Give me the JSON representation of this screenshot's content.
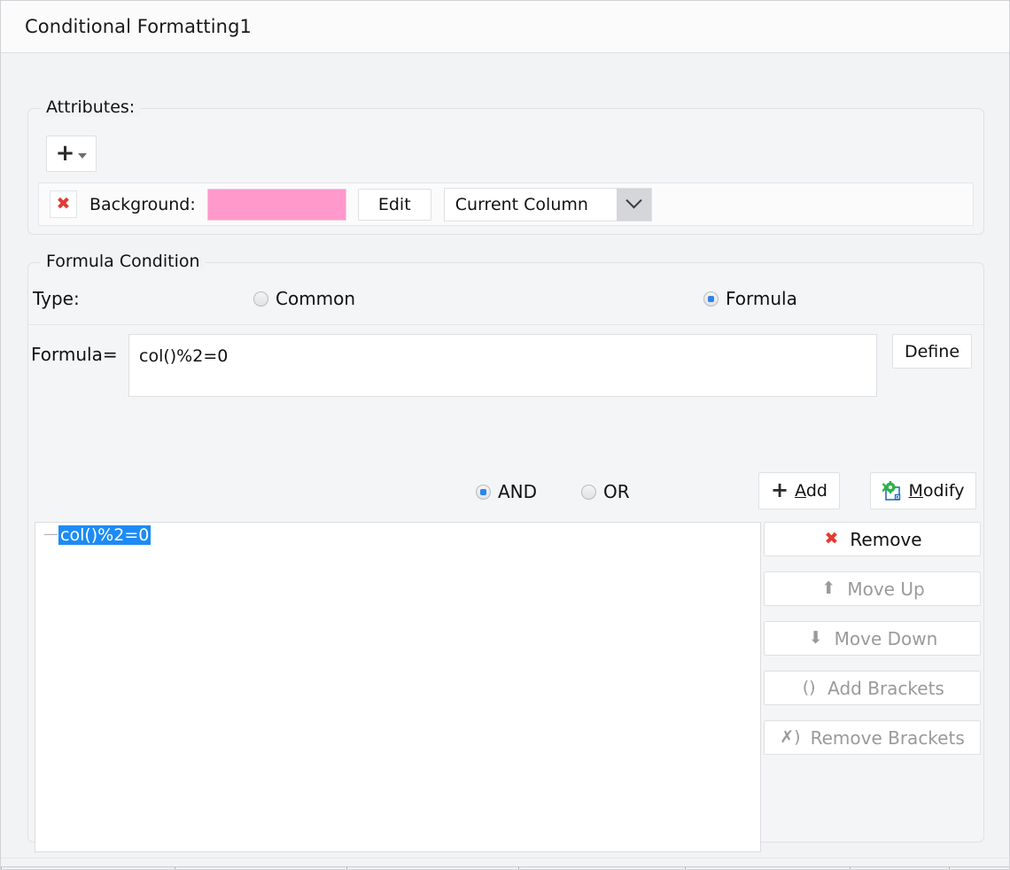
{
  "window": {
    "title": "Conditional Formatting1"
  },
  "attributes": {
    "group_label": "Attributes:",
    "add_button": {
      "icon": "plus-icon",
      "dropdown_icon": "caret-down-icon"
    },
    "rows": [
      {
        "remove_icon": "red-x-icon",
        "label": "Background:",
        "swatch_color": "#ff99cc",
        "edit_label": "Edit",
        "scope_value": "Current Column",
        "scope_arrow_icon": "chevron-down-icon"
      }
    ]
  },
  "formula_condition": {
    "group_label": "Formula Condition",
    "type_label": "Type:",
    "type_options": [
      {
        "label": "Common",
        "selected": false
      },
      {
        "label": "Formula",
        "selected": true
      }
    ],
    "formula_label": "Formula=",
    "formula_value": "col()%2=0",
    "define_label": "Define",
    "logic_options": [
      {
        "label": "AND",
        "selected": true
      },
      {
        "label": "OR",
        "selected": false
      }
    ],
    "add_label": "Add",
    "add_mnemonic": "A",
    "add_icon": "plus-icon",
    "modify_label": "Modify",
    "modify_mnemonic": "M",
    "modify_icon": "gear-settings-icon",
    "tree_items": [
      {
        "handle": "—",
        "label": "col()%2=0",
        "selected": true
      }
    ],
    "side_buttons": [
      {
        "label": "Remove",
        "icon": "red-x-icon",
        "glyph": "✖",
        "enabled": true
      },
      {
        "label": "Move Up",
        "icon": "arrow-up-icon",
        "glyph": "⬆",
        "enabled": false
      },
      {
        "label": "Move Down",
        "icon": "arrow-down-icon",
        "glyph": "⬇",
        "enabled": false
      },
      {
        "label": "Add Brackets",
        "icon": "brackets-icon",
        "glyph": "( )",
        "enabled": false
      },
      {
        "label": "Remove Brackets",
        "icon": "remove-brackets-icon",
        "glyph": "✗)",
        "enabled": false
      }
    ]
  },
  "colors": {
    "selection_blue": "#1d8bf5",
    "accent_red": "#e03b35",
    "swatch_pink": "#ff99cc",
    "radio_blue": "#2b86e8",
    "gear_green": "#2eb24a",
    "gear_outline_blue": "#1f6fbf"
  }
}
